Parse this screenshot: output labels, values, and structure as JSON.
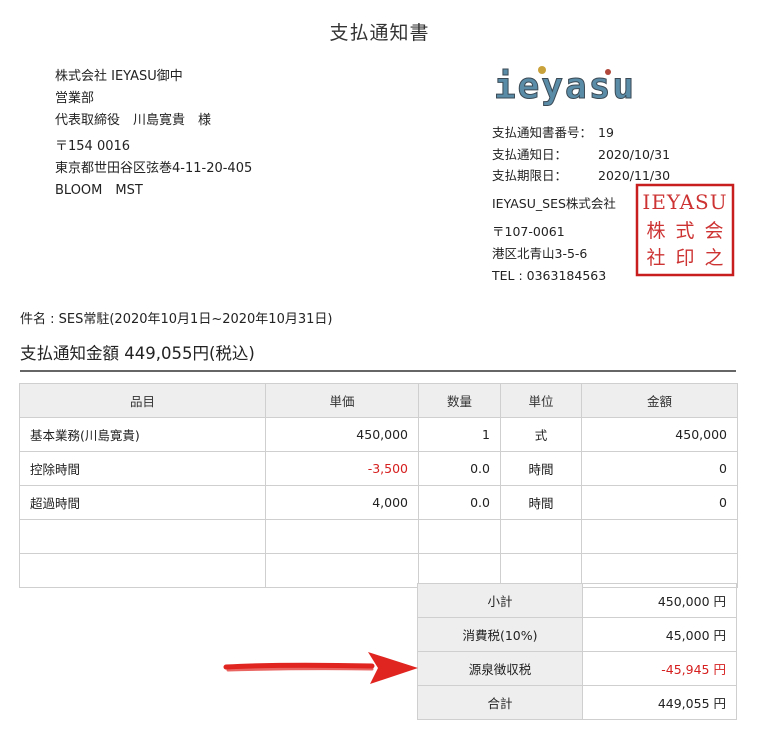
{
  "title": "支払通知書",
  "recipient": {
    "company": "株式会社 IEYASU御中",
    "dept": "営業部",
    "person": "代表取締役　川島寛貴　様",
    "postal": "〒154 0016",
    "address": "東京都世田谷区弦巻4-11-20-405",
    "building": "BLOOM　MST"
  },
  "logo_text": "ieyasu",
  "notice": {
    "number_label": "支払通知書番号：",
    "number_value": "19",
    "date_label": "支払通知日：",
    "date_value": "2020/10/31",
    "due_label": "支払期限日：",
    "due_value": "2020/11/30"
  },
  "issuer": {
    "name": "IEYASU_SES株式会社",
    "postal": "〒107-0061",
    "address": "港区北青山3-5-6",
    "tel": "TEL : 0363184563"
  },
  "seal": {
    "top": "IEYASU",
    "chars": [
      "株",
      "式",
      "会",
      "社",
      "印",
      "之"
    ]
  },
  "subject": "件名 : SES常駐(2020年10月1日~2020年10月31日)",
  "total_heading": "支払通知金額 449,055円(税込)",
  "table": {
    "headers": [
      "品目",
      "単価",
      "数量",
      "単位",
      "金額"
    ],
    "rows": [
      {
        "item": "基本業務(川島寛貴)",
        "price": "450,000",
        "qty": "1",
        "unit": "式",
        "amount": "450,000"
      },
      {
        "item": "控除時間",
        "price": "-3,500",
        "qty": "0.0",
        "unit": "時間",
        "amount": "0"
      },
      {
        "item": "超過時間",
        "price": "4,000",
        "qty": "0.0",
        "unit": "時間",
        "amount": "0"
      }
    ]
  },
  "summary": {
    "subtotal_label": "小計",
    "subtotal_value": "450,000 円",
    "tax_label": "消費税(10%)",
    "tax_value": "45,000 円",
    "withholding_label": "源泉徴収税",
    "withholding_value": "-45,945 円",
    "total_label": "合計",
    "total_value": "449,055 円"
  },
  "colors": {
    "negative": "#d62020",
    "seal": "#c81e1e",
    "arrow": "#e0241f",
    "header_bg": "#eeeeee"
  }
}
